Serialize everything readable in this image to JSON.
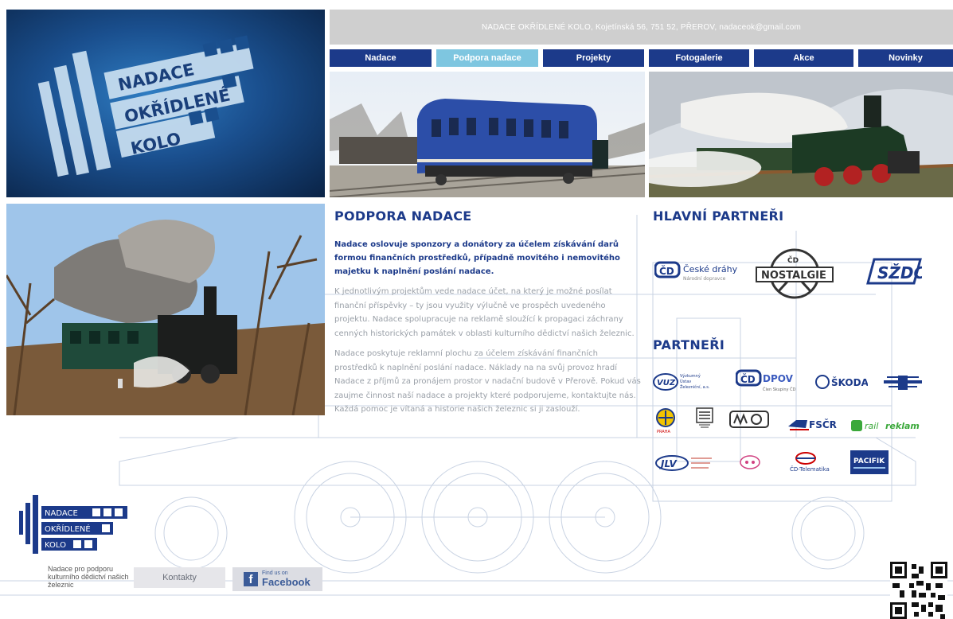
{
  "topbar": {
    "contact_line": "NADACE OKŘÍDLENÉ KOLO, Kojetínská 56, 751 52, PŘEROV, nadaceok@gmail.com"
  },
  "logo": {
    "line1": "NADACE",
    "line2": "OKŘÍDLENÉ",
    "line3": "KOLO"
  },
  "nav": {
    "items": [
      {
        "label": "Nadace"
      },
      {
        "label": "Podpora nadace"
      },
      {
        "label": "Projekty"
      },
      {
        "label": "Fotogalerie"
      },
      {
        "label": "Akce"
      },
      {
        "label": "Novinky"
      }
    ],
    "active_index": 1
  },
  "main": {
    "title": "PODPORA NADACE",
    "lead": "Nadace oslovuje sponzory a donátory za účelem získávání darů formou finančních prostředků, případně movitého i nemovitého majetku k naplnění poslání nadace.",
    "paragraph1": "K jednotlivým projektům vede nadace účet, na který je možné posílat finanční příspěvky – ty jsou využity výlučně ve prospěch uvedeného projektu. Nadace spolupracuje na reklamě sloužící k propagaci záchrany cenných historických památek v oblasti kulturního dědictví našich železnic.",
    "paragraph2": "Nadace poskytuje reklamní plochu za účelem získávání finančních prostředků k naplnění poslání nadace. Náklady na na svůj provoz hradí Nadace z příjmů za pronájem prostor v nadační budově v Přerově. Pokud vás zaujme činnost naší nadace a projekty které podporujeme, kontaktujte nás. Každá pomoc je vítaná a historie našich železnic si ji zaslouží."
  },
  "partners": {
    "main_title": "HLAVNÍ PARTNEŘI",
    "title": "PARTNEŘI",
    "main": {
      "cd_name": "České dráhy",
      "cd_sub": "Národní dopravce",
      "nostalgie_top": "ČD",
      "nostalgie": "NOSTALGIE",
      "szdc": "SŽDC"
    },
    "others": {
      "vuz": "VUZ",
      "vuz_text1": "Výzkumný",
      "vuz_text2": "Ústav",
      "vuz_text3": "Železniční, a.s.",
      "dpov": "DPOV",
      "dpov_sub": "Člen Skupiny ČD",
      "skoda": "ŠKODA",
      "praha": "PRAHA",
      "fscr": "FSČR",
      "railreklam_a": "rail",
      "railreklam_b": "reklam",
      "jlv": "JLV",
      "cd_telematika": "ČD-Telematika",
      "pacifik": "PACIFIK"
    }
  },
  "footer": {
    "caption": "Nadace pro podporu kulturního dědictví našich železnic",
    "contacts_label": "Kontakty",
    "fb_small": "Find us on",
    "fb_big": "Facebook",
    "fb_letter": "f"
  },
  "colors": {
    "brand_blue": "#1c3a8a",
    "active_tab": "#7ec6e0",
    "topbar_grey": "#cfcfcf",
    "body_text_grey": "#9aa0a8"
  }
}
